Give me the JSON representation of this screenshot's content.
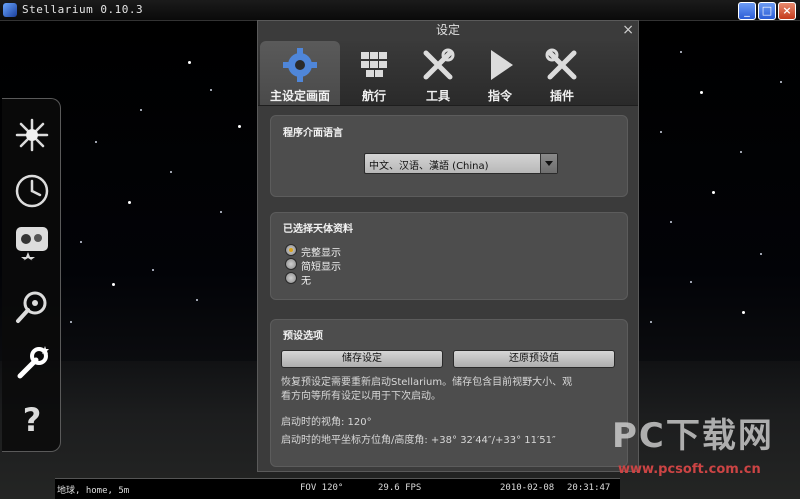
{
  "window": {
    "title": "Stellarium 0.10.3",
    "minimize": "_",
    "maximize": "□",
    "close": "×"
  },
  "left_bar": {
    "items": [
      {
        "id": "sky-view",
        "icon": "sky-burst-icon"
      },
      {
        "id": "date-time",
        "icon": "clock-icon"
      },
      {
        "id": "sky-culture",
        "icon": "constellation-icon"
      },
      {
        "id": "search",
        "icon": "search-icon"
      },
      {
        "id": "settings",
        "icon": "wrench-icon"
      },
      {
        "id": "help",
        "icon": "help-icon"
      }
    ]
  },
  "dialog": {
    "title": "设定",
    "close_label": "×",
    "tabs": [
      {
        "label": "主设定画面",
        "icon": "gear-icon"
      },
      {
        "label": "航行",
        "icon": "navigation-icon"
      },
      {
        "label": "工具",
        "icon": "tools-icon"
      },
      {
        "label": "指令",
        "icon": "play-icon"
      },
      {
        "label": "插件",
        "icon": "plugin-icon"
      }
    ],
    "language_panel": {
      "heading": "程序介面语言",
      "selected": "中文、汉语、漢語 (China)"
    },
    "objects_panel": {
      "heading": "已选择天体资料",
      "options": [
        {
          "label": "完整显示",
          "selected": true
        },
        {
          "label": "简短显示",
          "selected": false
        },
        {
          "label": "无",
          "selected": false
        }
      ]
    },
    "presets_panel": {
      "heading": "预设选项",
      "save_button": "储存设定",
      "restore_button": "还原预设值",
      "description_line1": "恢复预设定需要重新启动Stellarium。储存包含目前视野大小、观",
      "description_line2": "看方向等所有设定以用于下次启动。",
      "startup_fov": "启动时的视角: 120°",
      "startup_direction": "启动时的地平坐标方位角/高度角: +38° 32′44″/+33° 11′51″"
    }
  },
  "status_bar": {
    "location": "地球, home, 5m",
    "fov": "FOV 120°",
    "fps": "29.6 FPS",
    "date": "2010-02-08",
    "time": "20:31:47"
  },
  "watermark": {
    "big": "PC下载网",
    "small": "www.pcsoft.com.cn"
  }
}
